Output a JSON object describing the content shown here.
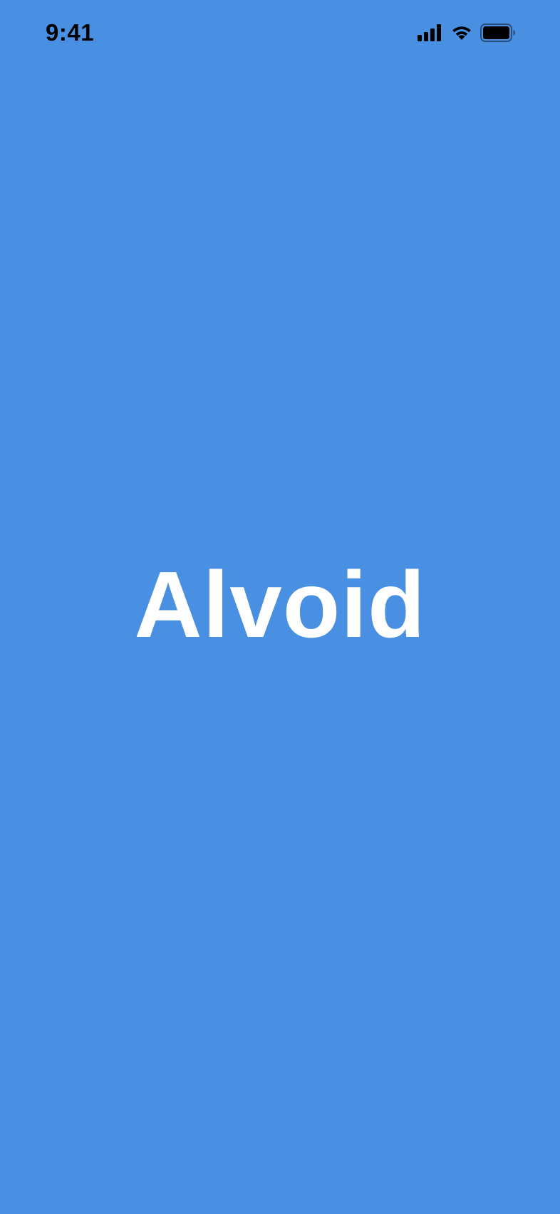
{
  "status_bar": {
    "time": "9:41",
    "icons": [
      "cellular-signal-icon",
      "wifi-icon",
      "battery-icon"
    ]
  },
  "splash": {
    "title": "Alvoid"
  },
  "colors": {
    "background": "#4a90e2",
    "title": "#ffffff",
    "status_text": "#000000"
  }
}
